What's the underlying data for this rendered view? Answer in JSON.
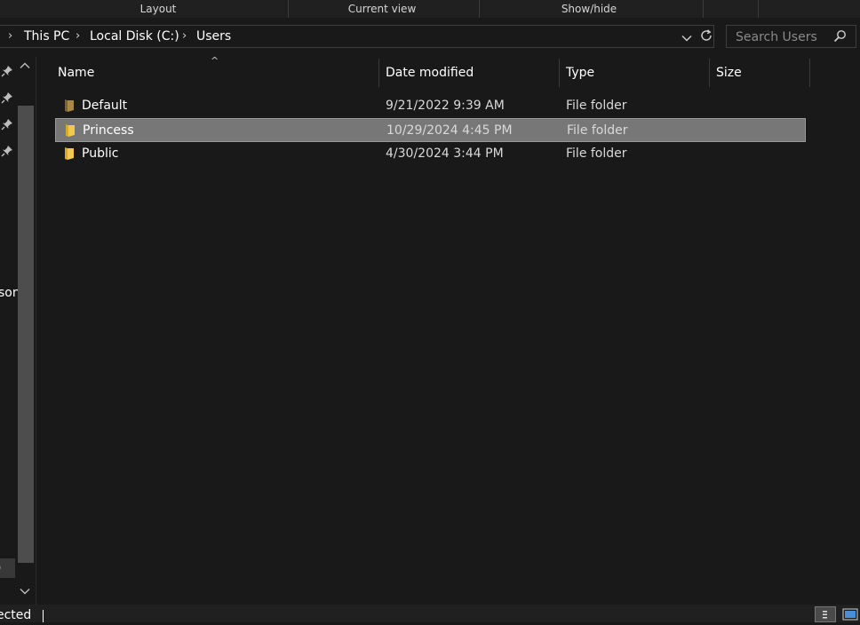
{
  "ribbon": {
    "groups": [
      "Layout",
      "Current view",
      "Show/hide"
    ]
  },
  "address": {
    "breadcrumbs": [
      "This PC",
      "Local Disk (C:)",
      "Users"
    ]
  },
  "search": {
    "placeholder": "Search Users"
  },
  "nav_pane": {
    "partial_text": "son",
    "partial_text_2": ")"
  },
  "columns": {
    "name": "Name",
    "date_modified": "Date modified",
    "type": "Type",
    "size": "Size"
  },
  "files": [
    {
      "name": "Default",
      "date_modified": "9/21/2022 9:39 AM",
      "type": "File folder",
      "size": "",
      "selected": false
    },
    {
      "name": "Princess",
      "date_modified": "10/29/2024 4:45 PM",
      "type": "File folder",
      "size": "",
      "selected": true
    },
    {
      "name": "Public",
      "date_modified": "4/30/2024 3:44 PM",
      "type": "File folder",
      "size": "",
      "selected": false
    }
  ],
  "status_bar": {
    "text": "ected"
  },
  "colors": {
    "background": "#191919",
    "selection": "#777777",
    "folder_yellow": "#f4c84f",
    "folder_dim": "#a88a45"
  },
  "icons": {
    "pin": "pin-icon",
    "folder": "folder-icon",
    "search": "search-icon",
    "refresh": "refresh-icon",
    "dropdown": "chevron-down-icon"
  }
}
